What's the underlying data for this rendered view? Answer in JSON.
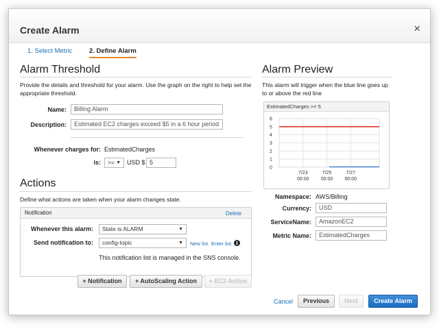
{
  "dialog": {
    "title": "Create Alarm",
    "close_icon": "×"
  },
  "steps": {
    "step1": "1. Select Metric",
    "step2": "2. Define Alarm"
  },
  "threshold": {
    "heading": "Alarm Threshold",
    "description": "Provide the details and threshold for your alarm. Use the graph on the right to help set the appropriate threshold.",
    "name_label": "Name:",
    "name_value": "Billing Alarm",
    "desc_label": "Description:",
    "desc_value": "Estimated EC2 charges exceed $5 in a 6 hour period",
    "charges_label": "Whenever charges for:",
    "charges_value": "EstimatedCharges",
    "is_label": "is:",
    "operator": ">=",
    "currency_prefix": "USD $",
    "amount": "5"
  },
  "actions": {
    "heading": "Actions",
    "description": "Define what actions are taken when your alarm changes state.",
    "notification": {
      "header": "Notification",
      "delete_link": "Delete",
      "whenever_label": "Whenever this alarm:",
      "state_value": "State is ALARM",
      "send_label": "Send notification to:",
      "topic_value": "config-topic",
      "new_list": "New list",
      "enter_list": "Enter list",
      "info_icon": "i",
      "managed_note": "This notification list is managed in the SNS console."
    },
    "buttons": {
      "add_notification": "+ Notification",
      "add_autoscaling": "+ AutoScaling Action",
      "add_ec2": "+ EC2 Action"
    }
  },
  "preview": {
    "heading": "Alarm Preview",
    "description": "This alarm will trigger when the blue line goes up to or above the red line",
    "namespace_label": "Namespace:",
    "namespace_value": "AWS/Billing",
    "currency_label": "Currency:",
    "currency_value": "USD",
    "service_label": "ServiceName:",
    "service_value": "AmazonEC2",
    "metric_label": "Metric Name:",
    "metric_value": "EstimatedCharges"
  },
  "chart_data": {
    "type": "line",
    "title": "EstimatedCharges >= 5",
    "x_ticks": [
      "7/23\n00:00",
      "7/25\n00:00",
      "7/27\n00:00"
    ],
    "y_ticks": [
      0,
      1,
      2,
      3,
      4,
      5,
      6
    ],
    "ylim": [
      0,
      6
    ],
    "threshold": 5,
    "series": [
      {
        "color": "#e8362b",
        "x": [
          0,
          4.2
        ],
        "values": [
          5,
          5
        ]
      },
      {
        "color": "#3b7fd4",
        "x": [
          2.1,
          4.2
        ],
        "values": [
          0.05,
          0.05
        ]
      }
    ],
    "x_tick_positions": [
      1,
      2,
      3
    ],
    "xlim": [
      0,
      4.2
    ]
  },
  "footer": {
    "cancel": "Cancel",
    "previous": "Previous",
    "next": "Next",
    "create": "Create Alarm"
  },
  "colors": {
    "accent": "#1a6eb7",
    "primary_button": "#1f74c8",
    "step_underline": "#e88a24",
    "threshold_line": "#e8362b",
    "metric_line": "#3b7fd4"
  }
}
